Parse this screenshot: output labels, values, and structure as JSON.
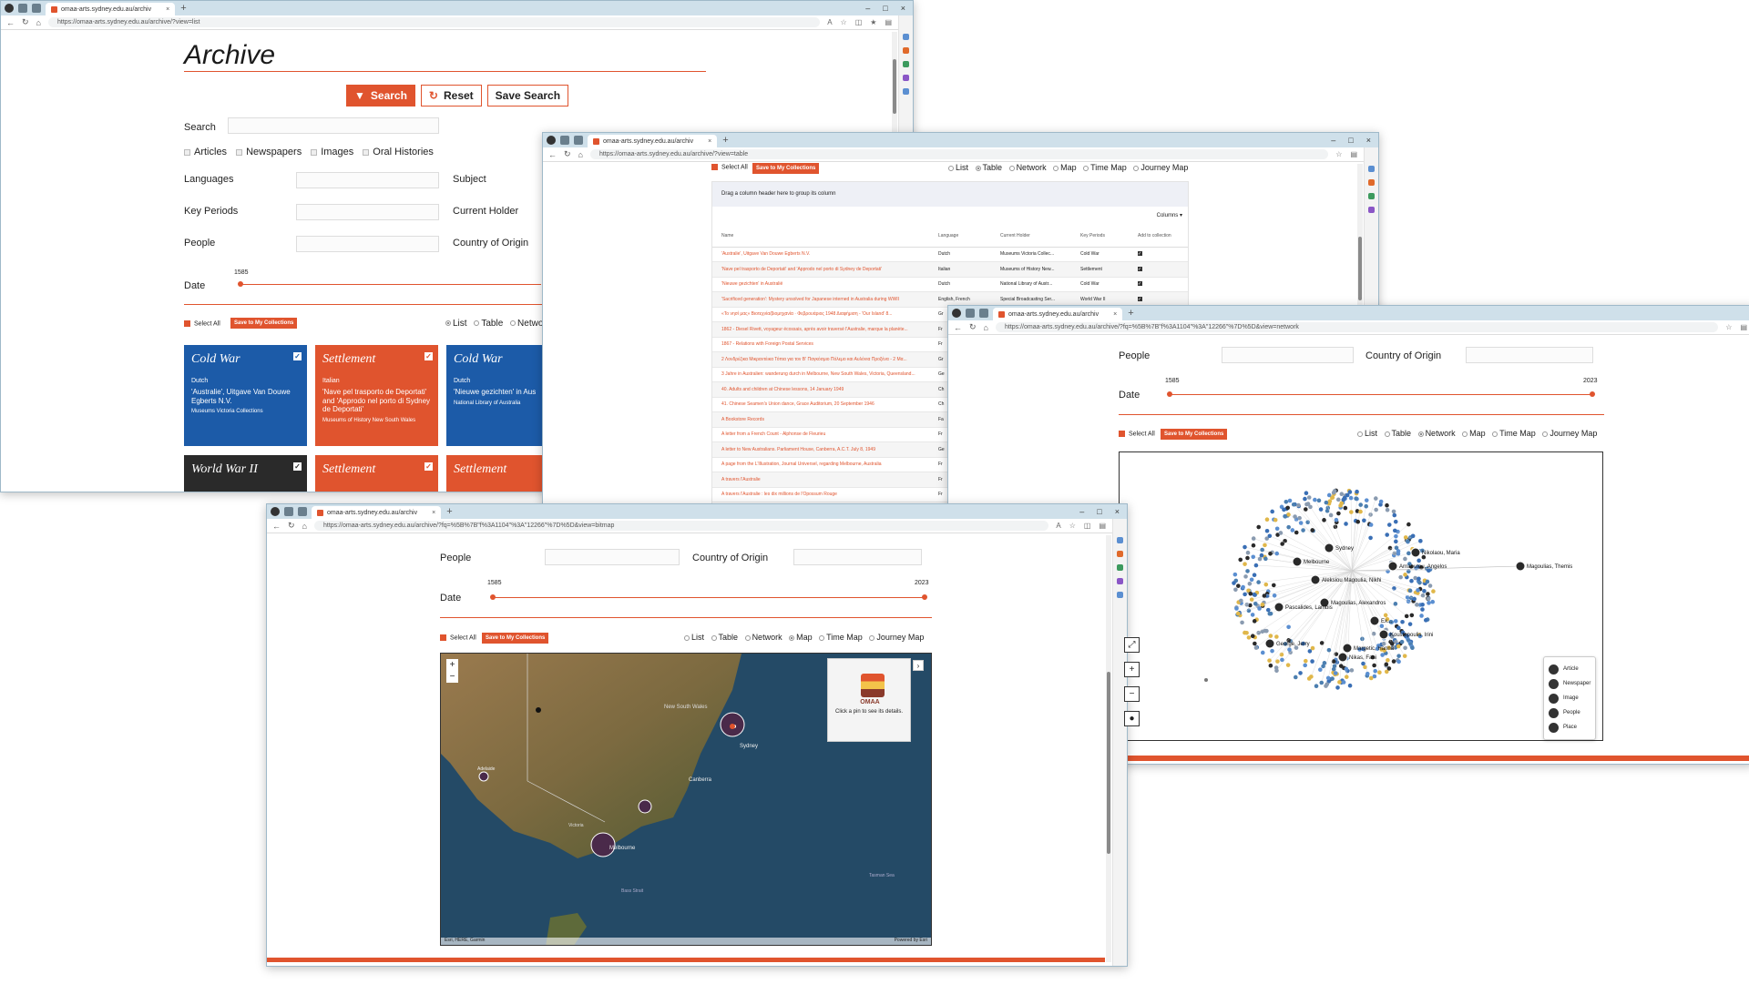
{
  "colors": {
    "accent": "#e0542e",
    "cold_war": "#1c5ba8",
    "ww2": "#2a2a2a",
    "settlement": "#e0542e"
  },
  "browser": {
    "tab_title": "omaa-arts.sydney.edu.au/archiv",
    "url_list": "https://omaa-arts.sydney.edu.au/archive/?view=list",
    "url_table": "https://omaa-arts.sydney.edu.au/archive/?view=table",
    "url_network": "https://omaa-arts.sydney.edu.au/archive/?fq=%5B%7B\"f%3A1104\"%3A\"12266\"%7D%5D&view=network",
    "url_map": "https://omaa-arts.sydney.edu.au/archive/?fq=%5B%7B\"f%3A1104\"%3A\"12266\"%7D%5D&view=bitmap"
  },
  "archive": {
    "heading": "Archive",
    "search_btn": "Search",
    "reset_btn": "Reset",
    "save_search_btn": "Save Search",
    "search_label": "Search",
    "types": [
      "Articles",
      "Newspapers",
      "Images",
      "Oral Histories"
    ],
    "filters": {
      "languages": "Languages",
      "subject": "Subject",
      "key_periods": "Key Periods",
      "current_holder": "Current Holder",
      "people": "People",
      "country": "Country of Origin",
      "date": "Date"
    },
    "date_min": "1585",
    "date_max": "2023",
    "select_all": "Select All",
    "save_collections": "Save to My Collections",
    "views": [
      "List",
      "Table",
      "Network",
      "Map",
      "Time Map",
      "Journey Map"
    ],
    "view_list_partial": "Networ"
  },
  "cards": [
    {
      "period": "Cold War",
      "lang": "Dutch",
      "title": "'Australie', Uitgave Van Douwe Egberts N.V.",
      "holder": "Museums Victoria Collections"
    },
    {
      "period": "Settlement",
      "lang": "Italian",
      "title": "'Nave pel trasporto de Deportati' and 'Approdo nel porto di Sydney de Deportati'",
      "holder": "Museums of History New South Wales"
    },
    {
      "period": "Cold War",
      "lang": "Dutch",
      "title": "'Nieuwe gezichten' in Aus",
      "holder": "National Library of Australia"
    },
    {
      "period": "World War II",
      "lang": "",
      "title": "",
      "holder": ""
    },
    {
      "period": "Settlement",
      "lang": "",
      "title": "",
      "holder": ""
    },
    {
      "period": "Settlement",
      "lang": "",
      "title": "",
      "holder": ""
    }
  ],
  "table": {
    "group_hint": "Drag a column header here to group its column",
    "columns_btn": "Columns",
    "headers": [
      "Name",
      "Language",
      "Current Holder",
      "Key Periods",
      "Add to collection"
    ],
    "rows": [
      [
        "'Australie', Uitgave Van Douwe Egberts N.V.",
        "Dutch",
        "Museums Victoria Collec...",
        "Cold War"
      ],
      [
        "'Nave pel trasporto de Deportati' and 'Approdo nel porto di Sydney de Deportati'",
        "Italian",
        "Museums of History New...",
        "Settlement"
      ],
      [
        "'Nieuwe gezichten' in Australië",
        "Dutch",
        "National Library of Austr...",
        "Cold War"
      ],
      [
        "'Sacrificed generation': Mystery unsolved for Japanese interned in Australia during WWII",
        "English, French",
        "Special Broadcasting Ser...",
        "World War II"
      ],
      [
        "«Το νησί μας» Βιοτεχνία/βιομηχανία · Φεβρουάριος 1948 Διαφήμιση - 'Our Island' 8...",
        "Gr",
        "",
        ""
      ],
      [
        "1862 - Diesel Rivett, voyageur écossais, après avoir traversé l'Australie, marque la planète...",
        "Fr",
        "",
        ""
      ],
      [
        "1867 - Relations with Foreign Postal Services",
        "Fr",
        "",
        ""
      ],
      [
        "2 Λονδρέζικα Μικραντέικα Τόπια για τον Β' Παγκόσμιο Πόλεμο και Αυλόνια Προξένα - 2 Μα...",
        "Gr",
        "",
        ""
      ],
      [
        "3 Jahre in Australien: wanderung durch in Melbourne, New South Wales, Victoria, Queensland...",
        "Ge",
        "",
        ""
      ],
      [
        "40. Adults and children at Chinese lessons, 14 January 1949",
        "Ch",
        "",
        ""
      ],
      [
        "41. Chinese Seamen's Union dance, Grace Auditorium, 20 September 1946",
        "Ch",
        "",
        ""
      ],
      [
        "A Bookstore Records",
        "Fa",
        "",
        ""
      ],
      [
        "A letter from a French Count - Alphonse de Fleurieu",
        "Fr",
        "",
        ""
      ],
      [
        "A letter to New Australians. Parliament House, Canberra, A.C.T. July 8, 1949",
        "Ge",
        "",
        ""
      ],
      [
        "A page from the L'Illustration, Journal Universel, regarding Melbourne, Australia",
        "Fr",
        "",
        ""
      ],
      [
        "A travers l'Australie",
        "Fr",
        "",
        ""
      ],
      [
        "A travers l'Australie : les dix millions de l'Opossum Rouge",
        "Fr",
        "",
        ""
      ]
    ]
  },
  "network": {
    "labels": [
      "Sydney",
      "Melbourne",
      "Aleksiou Magoulia, Nikhi",
      "Magoulias, Alexandros",
      "Nikolaou, Maria",
      "Magoulias, Themis",
      "Pascalides, Lambis",
      "George, Jerry",
      "Margetic, Hanna",
      "Koustopoulis, Irini",
      "Nikas, Fani",
      "Arnaoutou, Angelos",
      "Ex..."
    ],
    "legend": [
      "Article",
      "Newspaper",
      "Image",
      "People",
      "Place"
    ]
  },
  "map": {
    "popup": "Click a pin to see its details.",
    "logo": "OMAA",
    "places": [
      "Sydney",
      "Canberra",
      "Melbourne",
      "Adelaide",
      "New South Wales",
      "Victoria",
      "Bass Strait",
      "Tasman Sea"
    ],
    "attribution": "Esri, HERE, Garmin",
    "powered": "Powered by Esri"
  }
}
